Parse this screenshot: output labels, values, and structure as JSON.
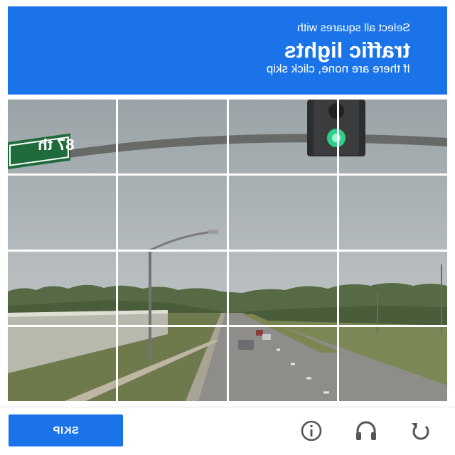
{
  "header": {
    "instruction_line1": "Select all squares with",
    "target_object": "traffic lights",
    "instruction_line3": "If there are none, click skip",
    "background_color": "#1a73e8"
  },
  "grid": {
    "rows": 4,
    "columns": 4,
    "sign_text": "87 th",
    "tiles": [
      {
        "row": 0,
        "col": 0
      },
      {
        "row": 0,
        "col": 1
      },
      {
        "row": 0,
        "col": 2
      },
      {
        "row": 0,
        "col": 3
      },
      {
        "row": 1,
        "col": 0
      },
      {
        "row": 1,
        "col": 1
      },
      {
        "row": 1,
        "col": 2
      },
      {
        "row": 1,
        "col": 3
      },
      {
        "row": 2,
        "col": 0
      },
      {
        "row": 2,
        "col": 1
      },
      {
        "row": 2,
        "col": 2
      },
      {
        "row": 2,
        "col": 3
      },
      {
        "row": 3,
        "col": 0
      },
      {
        "row": 3,
        "col": 1
      },
      {
        "row": 3,
        "col": 2
      },
      {
        "row": 3,
        "col": 3
      }
    ]
  },
  "footer": {
    "skip_label": "SKIP",
    "icons": [
      "reload-icon",
      "audio-headphones-icon",
      "info-icon"
    ],
    "accent_color": "#1a73e8",
    "icon_color": "#555555"
  }
}
